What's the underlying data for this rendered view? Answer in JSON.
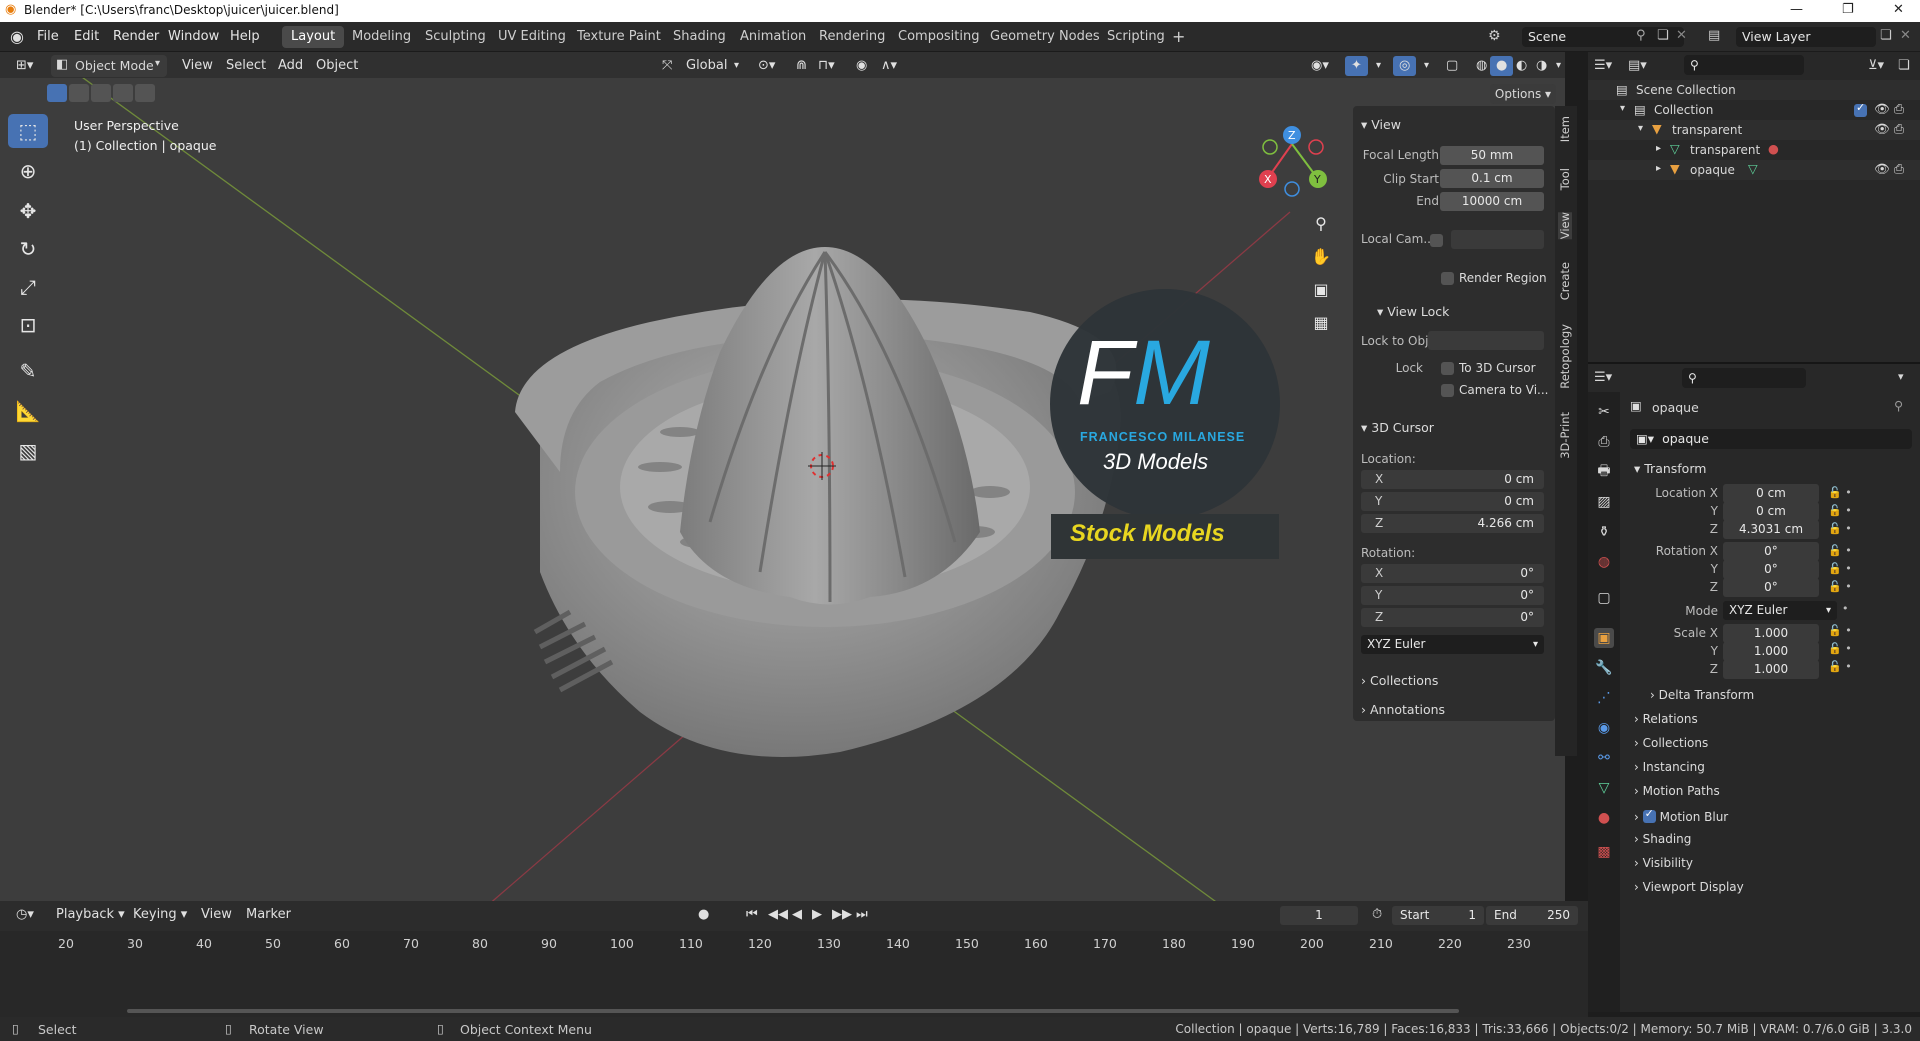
{
  "window": {
    "title": "Blender* [C:\\Users\\franc\\Desktop\\juicer\\juicer.blend]"
  },
  "menu": {
    "file": "File",
    "edit": "Edit",
    "render": "Render",
    "window": "Window",
    "help": "Help"
  },
  "workspaces": [
    "Layout",
    "Modeling",
    "Sculpting",
    "UV Editing",
    "Texture Paint",
    "Shading",
    "Animation",
    "Rendering",
    "Compositing",
    "Geometry Nodes",
    "Scripting"
  ],
  "active_workspace": "Layout",
  "scene": {
    "name": "Scene",
    "view_layer": "View Layer"
  },
  "viewport_header": {
    "mode": "Object Mode",
    "view": "View",
    "select": "Select",
    "add": "Add",
    "object": "Object",
    "orientation": "Global",
    "options": "Options"
  },
  "viewport_overlay": {
    "perspective": "User Perspective",
    "collection": "(1) Collection | opaque"
  },
  "watermark": {
    "logo": "FM",
    "company": "FRANCESCO MILANESE",
    "line": "3D Models",
    "banner": "Stock Models"
  },
  "npanel": {
    "view_title": "View",
    "focal_length_label": "Focal Length",
    "focal_length": "50 mm",
    "clip_start_label": "Clip Start",
    "clip_start": "0.1 cm",
    "clip_end_label": "End",
    "clip_end": "10000 cm",
    "local_cam_label": "Local Cam...",
    "render_region": "Render Region",
    "view_lock_title": "View Lock",
    "lock_to_obj_label": "Lock to Obj...",
    "lock_label": "Lock",
    "to_3d_cursor": "To 3D Cursor",
    "camera_to_view": "Camera to Vi...",
    "cursor_title": "3D Cursor",
    "location_label": "Location:",
    "loc": [
      {
        "axis": "X",
        "value": "0 cm"
      },
      {
        "axis": "Y",
        "value": "0 cm"
      },
      {
        "axis": "Z",
        "value": "4.266 cm"
      }
    ],
    "rotation_label": "Rotation:",
    "rot": [
      {
        "axis": "X",
        "value": "0°"
      },
      {
        "axis": "Y",
        "value": "0°"
      },
      {
        "axis": "Z",
        "value": "0°"
      }
    ],
    "rotation_mode": "XYZ Euler",
    "collections": "Collections",
    "annotations": "Annotations",
    "tabs": [
      "Item",
      "Tool",
      "View",
      "Create",
      "Retopology",
      "3D-Print"
    ]
  },
  "outliner": {
    "scene_collection": "Scene Collection",
    "collection": "Collection",
    "items": [
      {
        "name": "transparent"
      },
      {
        "name": "transparent"
      },
      {
        "name": "opaque"
      }
    ]
  },
  "properties": {
    "object_name": "opaque",
    "datablock": "opaque",
    "transform": "Transform",
    "location_x_label": "Location X",
    "location": [
      "0 cm",
      "0 cm",
      "4.3031 cm"
    ],
    "rotation_x_label": "Rotation X",
    "rotation": [
      "0°",
      "0°",
      "0°"
    ],
    "mode_label": "Mode",
    "mode": "XYZ Euler",
    "scale_x_label": "Scale X",
    "scale": [
      "1.000",
      "1.000",
      "1.000"
    ],
    "y": "Y",
    "z": "Z",
    "delta": "Delta Transform",
    "sections": [
      "Relations",
      "Collections",
      "Instancing",
      "Motion Paths",
      "Motion Blur",
      "Shading",
      "Visibility",
      "Viewport Display"
    ]
  },
  "timeline": {
    "playback": "Playback",
    "keying": "Keying",
    "view": "View",
    "marker": "Marker",
    "current_frame": "1",
    "start_label": "Start",
    "start": "1",
    "end_label": "End",
    "end": "250",
    "ticks": [
      "20",
      "30",
      "40",
      "50",
      "60",
      "70",
      "80",
      "90",
      "100",
      "110",
      "120",
      "130",
      "140",
      "150",
      "160",
      "170",
      "180",
      "190",
      "200",
      "210",
      "220",
      "230"
    ]
  },
  "status": {
    "select": "Select",
    "rotate": "Rotate View",
    "context": "Object Context Menu",
    "stats": "Collection | opaque | Verts:16,789 | Faces:16,833 | Tris:33,666 | Objects:0/2 | Memory: 50.7 MiB | VRAM: 0.7/6.0 GiB | 3.3.0"
  },
  "colors": {
    "accent": "#4772b3",
    "x_axis": "#e0404f",
    "y_axis": "#7fbf3f",
    "z_axis": "#3f8fe0",
    "banner_text": "#e8d620"
  }
}
